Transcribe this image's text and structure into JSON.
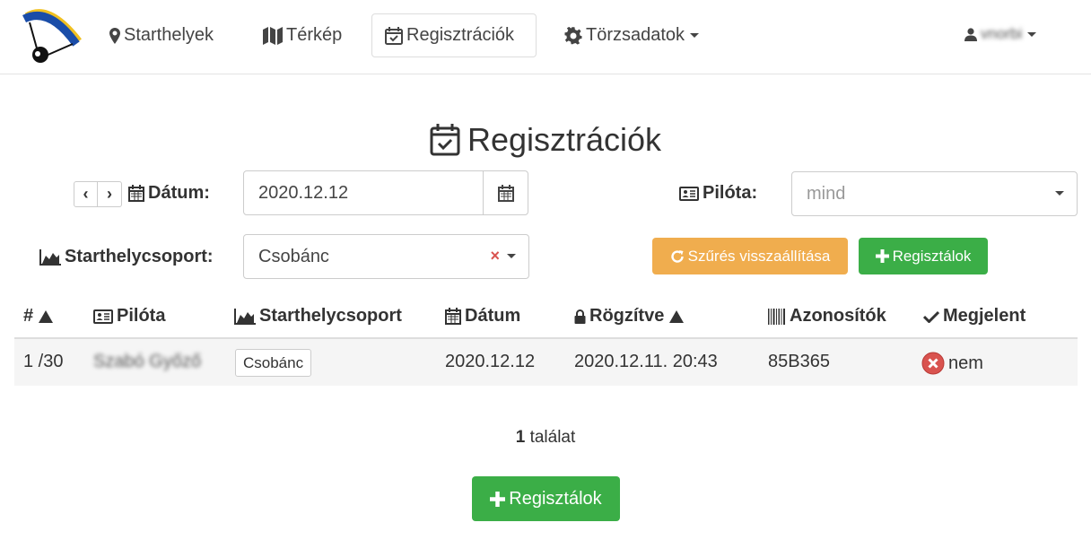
{
  "navbar": {
    "items": [
      {
        "label": "Starthelyek",
        "icon": "map-marker-icon"
      },
      {
        "label": "Térkép",
        "icon": "map-icon"
      },
      {
        "label": "Regisztrációk",
        "icon": "calendar-check-icon",
        "active": true
      },
      {
        "label": "Törzsadatok",
        "icon": "gear-icon",
        "dropdown": true
      }
    ],
    "user": {
      "name": "vnorbi",
      "icon": "user-icon"
    }
  },
  "page": {
    "title": "Regisztrációk"
  },
  "filters": {
    "date_label": "Dátum:",
    "date_value": "2020.12.12",
    "pilot_label": "Pilóta:",
    "pilot_value": "mind",
    "group_label": "Starthelycsoport:",
    "group_value": "Csobánc",
    "reset_button": "Szűrés visszaállítása",
    "register_button": "Regisztálok"
  },
  "table": {
    "headers": [
      "#",
      "Pilóta",
      "Starthelycsoport",
      "Dátum",
      "Rögzítve",
      "Azonosítók",
      "Megjelent"
    ],
    "rows": [
      {
        "num": "1 /30",
        "pilot": "Szabó Győző",
        "group": "Csobánc",
        "date": "2020.12.12",
        "recorded": "2020.12.11. 20:43",
        "ids": "85B365",
        "appeared": "nem"
      }
    ]
  },
  "result": {
    "count": "1",
    "label": "találat"
  },
  "bottom": {
    "register_button": "Regisztálok"
  },
  "colors": {
    "warning": "#f0ad4e",
    "success": "#3bae47",
    "danger": "#d9534f"
  }
}
